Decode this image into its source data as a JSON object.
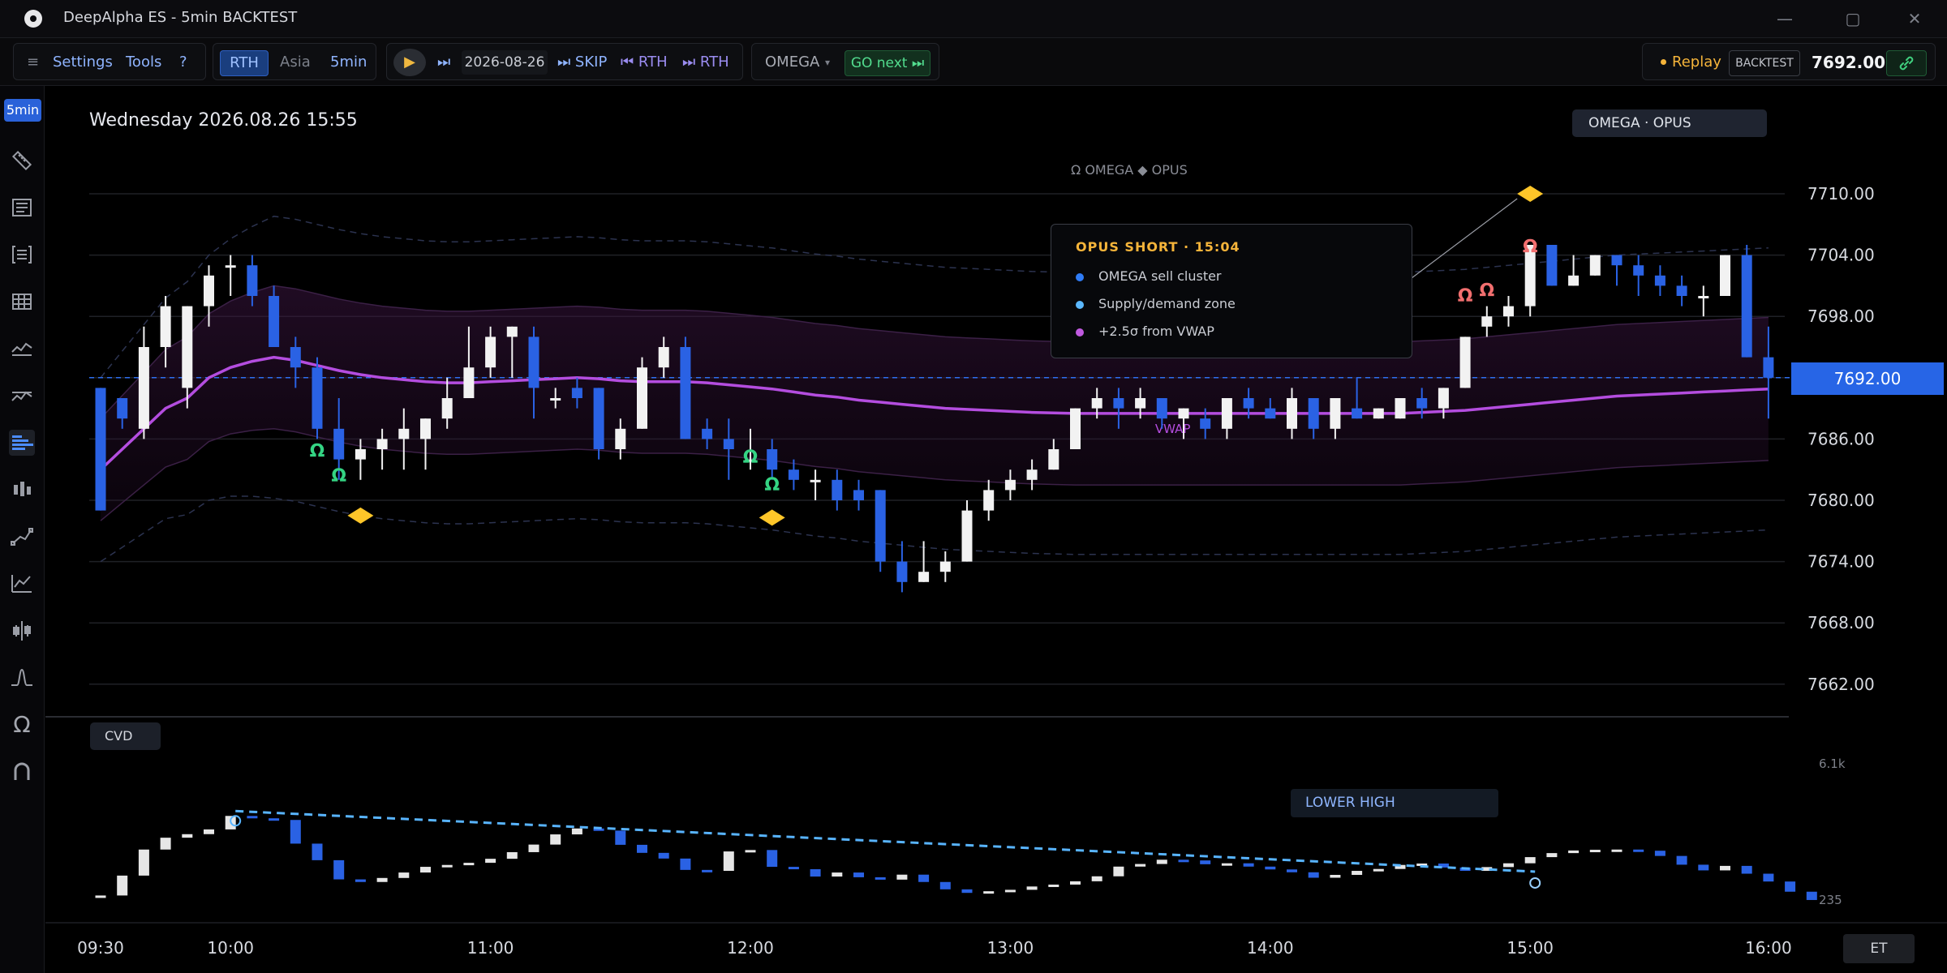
{
  "window": {
    "title": "DeepAlpha ES - 5min BACKTEST",
    "minimize": "—",
    "maximize": "▢",
    "close": "✕"
  },
  "toolbar": {
    "menu": "≡",
    "settings": "Settings",
    "tools": "Tools",
    "help": "?",
    "session_rth": "RTH",
    "session_asia": "Asia",
    "timeframe": "5min",
    "play": "▶",
    "step": "⏭",
    "date": "2026-08-26",
    "skip": "⏭ SKIP",
    "prev_rth": "⏮ RTH",
    "next_rth": "⏭ RTH",
    "indicator": "OMEGA",
    "indicator_caret": "▾",
    "go_next": "GO next ⏭",
    "replay": "Replay",
    "backtest": "BACKTEST",
    "last_price": "7692.00"
  },
  "sidebar": {
    "timeframe_badge": "5min",
    "icons": [
      "ruler-icon",
      "order-list-icon",
      "bracket-icon",
      "grid-icon",
      "indicator-icon",
      "indicator-alt-icon",
      "volume-profile-icon",
      "footprint-icon",
      "trend-tool-icon",
      "chart-tool-icon",
      "signals-icon",
      "peak-icon",
      "omega-icon",
      "magnet-icon"
    ]
  },
  "chart": {
    "date_label": "Wednesday 2026.08.26 15:55",
    "strategy_label": "OMEGA · OPUS",
    "caption": "Ω OMEGA ◆ OPUS",
    "vwap_label": "VWAP",
    "current_price": "7692.00",
    "colors": {
      "up": "#f2f2f2",
      "down": "#2a62e4",
      "vwap": "#b44ddf",
      "band": "#2a0f2f",
      "buy_signal": "#34d483",
      "sell_signal": "#f26f6f",
      "diamond": "#ffc629",
      "price_line": "#2e6ff0"
    },
    "popup": {
      "title": "OPUS SHORT · 15:04",
      "items": [
        {
          "text": "OMEGA sell cluster",
          "color": "#2f7cf6"
        },
        {
          "text": "Supply/demand zone",
          "color": "#5bb8ff"
        },
        {
          "text": "+2.5σ from VWAP",
          "color": "#c05ae0"
        }
      ]
    },
    "cvd_label": "CVD",
    "cvd_axis": [
      "6.1k",
      "235"
    ],
    "lower_high_label": "LOWER HIGH",
    "timezone": "ET"
  },
  "chart_data": {
    "type": "candlestick",
    "interval": "5min",
    "date": "2026-08-26",
    "price_axis": [
      "7710.00",
      "7704.00",
      "7698.00",
      "7692.00",
      "7686.00",
      "7680.00",
      "7674.00",
      "7668.00",
      "7662.00"
    ],
    "ylim": [
      7658,
      7716
    ],
    "time_axis": [
      "09:30",
      "10:00",
      "11:00",
      "12:00",
      "13:00",
      "14:00",
      "15:00",
      "16:00"
    ],
    "x_range": [
      0,
      78
    ],
    "time_ticks": [
      0,
      6,
      18,
      30,
      42,
      54,
      66,
      77
    ],
    "ohlc": [
      [
        7691,
        7691,
        7679,
        7679
      ],
      [
        7690,
        7690,
        7687,
        7688
      ],
      [
        7687,
        7697,
        7686,
        7695
      ],
      [
        7695,
        7700,
        7693,
        7699
      ],
      [
        7691,
        7699,
        7689,
        7699
      ],
      [
        7699,
        7703,
        7697,
        7702
      ],
      [
        7703,
        7704,
        7700,
        7703
      ],
      [
        7703,
        7704,
        7699,
        7700
      ],
      [
        7700,
        7701,
        7695,
        7695
      ],
      [
        7695,
        7696,
        7691,
        7693
      ],
      [
        7693,
        7694,
        7686,
        7687
      ],
      [
        7687,
        7690,
        7682,
        7684
      ],
      [
        7684,
        7686,
        7682,
        7685
      ],
      [
        7685,
        7687,
        7683,
        7686
      ],
      [
        7686,
        7689,
        7683,
        7687
      ],
      [
        7686,
        7688,
        7683,
        7688
      ],
      [
        7688,
        7692,
        7687,
        7690
      ],
      [
        7690,
        7697,
        7690,
        7693
      ],
      [
        7693,
        7697,
        7692,
        7696
      ],
      [
        7696,
        7697,
        7692,
        7697
      ],
      [
        7696,
        7697,
        7688,
        7691
      ],
      [
        7690,
        7691,
        7689,
        7690
      ],
      [
        7691,
        7692,
        7689,
        7690
      ],
      [
        7691,
        7691,
        7684,
        7685
      ],
      [
        7685,
        7688,
        7684,
        7687
      ],
      [
        7687,
        7694,
        7687,
        7693
      ],
      [
        7693,
        7696,
        7692,
        7695
      ],
      [
        7695,
        7696,
        7686,
        7686
      ],
      [
        7687,
        7688,
        7685,
        7686
      ],
      [
        7686,
        7688,
        7682,
        7685
      ],
      [
        7684,
        7687,
        7683,
        7684
      ],
      [
        7685,
        7686,
        7682,
        7683
      ],
      [
        7683,
        7684,
        7681,
        7682
      ],
      [
        7682,
        7683,
        7680,
        7682
      ],
      [
        7682,
        7683,
        7679,
        7680
      ],
      [
        7681,
        7682,
        7679,
        7680
      ],
      [
        7681,
        7681,
        7673,
        7674
      ],
      [
        7674,
        7676,
        7671,
        7672
      ],
      [
        7672,
        7676,
        7672,
        7673
      ],
      [
        7673,
        7675,
        7672,
        7674
      ],
      [
        7674,
        7680,
        7674,
        7679
      ],
      [
        7679,
        7682,
        7678,
        7681
      ],
      [
        7681,
        7683,
        7680,
        7682
      ],
      [
        7682,
        7684,
        7681,
        7683
      ],
      [
        7683,
        7686,
        7683,
        7685
      ],
      [
        7685,
        7689,
        7685,
        7689
      ],
      [
        7689,
        7691,
        7688,
        7690
      ],
      [
        7690,
        7691,
        7687,
        7689
      ],
      [
        7689,
        7691,
        7688,
        7690
      ],
      [
        7690,
        7690,
        7687,
        7688
      ],
      [
        7688,
        7689,
        7686,
        7689
      ],
      [
        7688,
        7689,
        7686,
        7687
      ],
      [
        7687,
        7690,
        7686,
        7690
      ],
      [
        7690,
        7691,
        7688,
        7689
      ],
      [
        7689,
        7690,
        7688,
        7688
      ],
      [
        7687,
        7691,
        7686,
        7690
      ],
      [
        7690,
        7690,
        7686,
        7687
      ],
      [
        7687,
        7690,
        7686,
        7690
      ],
      [
        7689,
        7692,
        7688,
        7688
      ],
      [
        7688,
        7689,
        7688,
        7689
      ],
      [
        7688,
        7690,
        7688,
        7690
      ],
      [
        7690,
        7691,
        7688,
        7689
      ],
      [
        7689,
        7691,
        7688,
        7691
      ],
      [
        7691,
        7696,
        7691,
        7696
      ],
      [
        7697,
        7699,
        7696,
        7698
      ],
      [
        7698,
        7700,
        7697,
        7699
      ],
      [
        7699,
        7705,
        7698,
        7705
      ],
      [
        7705,
        7705,
        7701,
        7701
      ],
      [
        7701,
        7704,
        7701,
        7702
      ],
      [
        7702,
        7704,
        7702,
        7704
      ],
      [
        7704,
        7704,
        7701,
        7703
      ],
      [
        7703,
        7704,
        7700,
        7702
      ],
      [
        7702,
        7703,
        7700,
        7701
      ],
      [
        7701,
        7702,
        7699,
        7700
      ],
      [
        7700,
        7701,
        7698,
        7700
      ],
      [
        7700,
        7704,
        7700,
        7704
      ],
      [
        7704,
        7705,
        7694,
        7694
      ],
      [
        7694,
        7697,
        7688,
        7692
      ]
    ],
    "vwap": [
      7683,
      7685,
      7687,
      7689,
      7690,
      7692,
      7693,
      7693.6,
      7694,
      7693.7,
      7693.2,
      7692.7,
      7692.3,
      7692,
      7691.8,
      7691.6,
      7691.5,
      7691.5,
      7691.6,
      7691.7,
      7691.8,
      7691.9,
      7692,
      7691.9,
      7691.7,
      7691.6,
      7691.6,
      7691.6,
      7691.5,
      7691.3,
      7691.1,
      7690.9,
      7690.6,
      7690.3,
      7690.1,
      7689.8,
      7689.6,
      7689.4,
      7689.2,
      7689,
      7688.9,
      7688.8,
      7688.7,
      7688.6,
      7688.55,
      7688.5,
      7688.5,
      7688.5,
      7688.5,
      7688.5,
      7688.5,
      7688.5,
      7688.5,
      7688.5,
      7688.5,
      7688.5,
      7688.5,
      7688.5,
      7688.5,
      7688.5,
      7688.5,
      7688.6,
      7688.7,
      7688.8,
      7689,
      7689.2,
      7689.4,
      7689.6,
      7689.8,
      7690,
      7690.2,
      7690.3,
      7690.4,
      7690.5,
      7690.6,
      7690.7,
      7690.8,
      7690.9
    ],
    "omega_buy_signals": [
      [
        10,
        7684.8
      ],
      [
        11,
        7682.4
      ],
      [
        30,
        7684.2
      ],
      [
        31,
        7681.5
      ]
    ],
    "omega_sell_signals": [
      [
        63,
        7700
      ],
      [
        64,
        7700.5
      ],
      [
        66,
        7704.8
      ]
    ],
    "opus_diamonds": [
      [
        12,
        7678.5
      ],
      [
        31,
        7678.3
      ],
      [
        66,
        7710
      ]
    ],
    "cvd": [
      [
        235,
        260
      ],
      [
        260,
        1100
      ],
      [
        1100,
        2200
      ],
      [
        2200,
        2700
      ],
      [
        2700,
        2850
      ],
      [
        2850,
        3050
      ],
      [
        3050,
        3620
      ],
      [
        3620,
        3520
      ],
      [
        3520,
        3450
      ],
      [
        3450,
        2450
      ],
      [
        2450,
        1750
      ],
      [
        1750,
        940
      ],
      [
        940,
        830
      ],
      [
        830,
        1000
      ],
      [
        1000,
        1230
      ],
      [
        1230,
        1470
      ],
      [
        1470,
        1550
      ],
      [
        1550,
        1640
      ],
      [
        1640,
        1810
      ],
      [
        1810,
        2090
      ],
      [
        2090,
        2410
      ],
      [
        2410,
        2840
      ],
      [
        2840,
        3090
      ],
      [
        3090,
        3000
      ],
      [
        3000,
        2400
      ],
      [
        2400,
        2060
      ],
      [
        2060,
        1820
      ],
      [
        1820,
        1340
      ],
      [
        1340,
        1300
      ],
      [
        1300,
        2120
      ],
      [
        2120,
        2180
      ],
      [
        2180,
        1470
      ],
      [
        1470,
        1370
      ],
      [
        1370,
        1060
      ],
      [
        1060,
        1230
      ],
      [
        1230,
        1030
      ],
      [
        1030,
        930
      ],
      [
        930,
        1140
      ],
      [
        1140,
        830
      ],
      [
        830,
        520
      ],
      [
        520,
        370
      ],
      [
        370,
        440
      ],
      [
        440,
        500
      ],
      [
        500,
        640
      ],
      [
        640,
        720
      ],
      [
        720,
        860
      ],
      [
        860,
        1070
      ],
      [
        1070,
        1480
      ],
      [
        1480,
        1590
      ],
      [
        1590,
        1770
      ],
      [
        1770,
        1740
      ],
      [
        1740,
        1580
      ],
      [
        1580,
        1620
      ],
      [
        1620,
        1480
      ],
      [
        1480,
        1360
      ],
      [
        1360,
        1240
      ],
      [
        1240,
        1010
      ],
      [
        1010,
        1130
      ],
      [
        1130,
        1300
      ],
      [
        1300,
        1380
      ],
      [
        1380,
        1550
      ],
      [
        1550,
        1610
      ],
      [
        1610,
        1440
      ],
      [
        1440,
        1300
      ],
      [
        1300,
        1460
      ],
      [
        1460,
        1620
      ],
      [
        1620,
        1880
      ],
      [
        1880,
        2050
      ],
      [
        2050,
        2160
      ],
      [
        2160,
        2190
      ],
      [
        2190,
        2200
      ],
      [
        2200,
        2150
      ],
      [
        2150,
        1930
      ],
      [
        1930,
        1560
      ],
      [
        1560,
        1320
      ],
      [
        1320,
        1510
      ],
      [
        1510,
        1180
      ],
      [
        1180,
        850
      ],
      [
        850,
        420
      ],
      [
        420,
        70
      ]
    ],
    "cvd_trendline": [
      [
        6,
        3620
      ],
      [
        66,
        1200
      ]
    ]
  }
}
